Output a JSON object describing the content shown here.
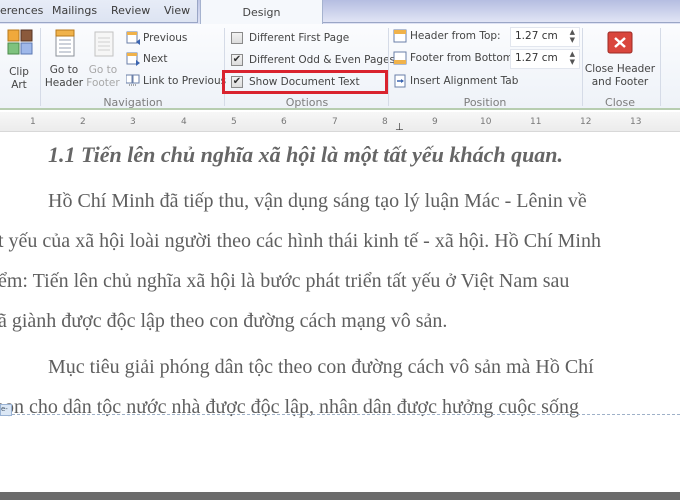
{
  "tabs": {
    "items": [
      "erences",
      "Mailings",
      "Review",
      "View"
    ],
    "active": "Design"
  },
  "ribbon": {
    "insert": {
      "clip_art": "Clip\nArt"
    },
    "navigation": {
      "group_label": "Navigation",
      "go_to_header": "Go to\nHeader",
      "go_to_footer": "Go to\nFooter",
      "previous": "Previous",
      "next": "Next",
      "link_to_previous": "Link to Previous"
    },
    "options": {
      "group_label": "Options",
      "different_first_page": {
        "label": "Different First Page",
        "checked": false
      },
      "different_odd_even": {
        "label": "Different Odd & Even Pages",
        "checked": true
      },
      "show_document_text": {
        "label": "Show Document Text",
        "checked": true
      }
    },
    "position": {
      "group_label": "Position",
      "header_from_top": {
        "label": "Header from Top:",
        "value": "1.27 cm"
      },
      "footer_from_bottom": {
        "label": "Footer from Bottom:",
        "value": "1.27 cm"
      },
      "insert_alignment_tab": "Insert Alignment Tab"
    },
    "close": {
      "group_label": "Close",
      "close_header_footer": "Close Header\nand Footer"
    }
  },
  "ruler": {
    "ticks": [
      "1",
      "2",
      "3",
      "4",
      "5",
      "6",
      "7",
      "8",
      "9",
      "10",
      "11",
      "12",
      "13"
    ]
  },
  "document": {
    "heading": "1.1 Tiến lên chủ nghĩa xã hội là một tất yếu khách quan.",
    "lines": [
      "Hồ Chí Minh đã tiếp thu, vận dụng sáng tạo lý luận Mác - Lênin về",
      "t yếu của xã hội loài người theo các hình thái kinh tế - xã hội. Hồ Chí Minh",
      "ểm: Tiến lên chủ nghĩa xã hội là bước phát triển tất yếu ở Việt Nam sau",
      "ã giành được độc lập theo con đường cách mạng vô sản.",
      "Mục tiêu giải phóng dân tộc theo con đường cách vô sản mà Hồ Chí",
      "họn cho dân tộc nước nhà được độc lập, nhân dân được hưởng cuộc sống"
    ],
    "header_marker": "e-"
  }
}
